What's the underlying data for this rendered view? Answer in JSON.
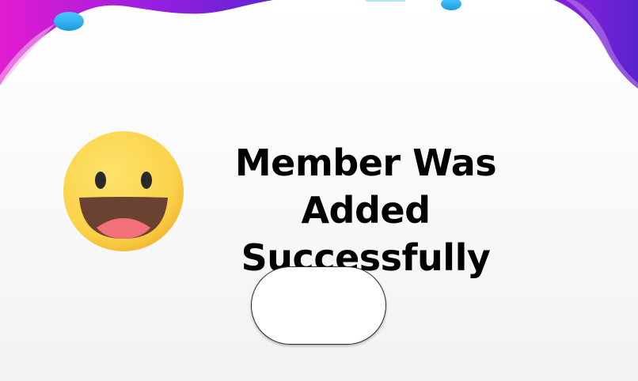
{
  "dialog": {
    "message_line1": "Member Was Added",
    "message_line2": "Successfully",
    "ok_button_label": "",
    "icon": "laughing-face-icon"
  },
  "colors": {
    "text": "#000000",
    "wave_magenta": "#e21cd0",
    "wave_purple": "#6a22d6",
    "blob_blue": "#2db2f0",
    "emoji_yellow": "#fbd24a",
    "emoji_mouth": "#6b4132",
    "emoji_tongue": "#f1707a"
  }
}
